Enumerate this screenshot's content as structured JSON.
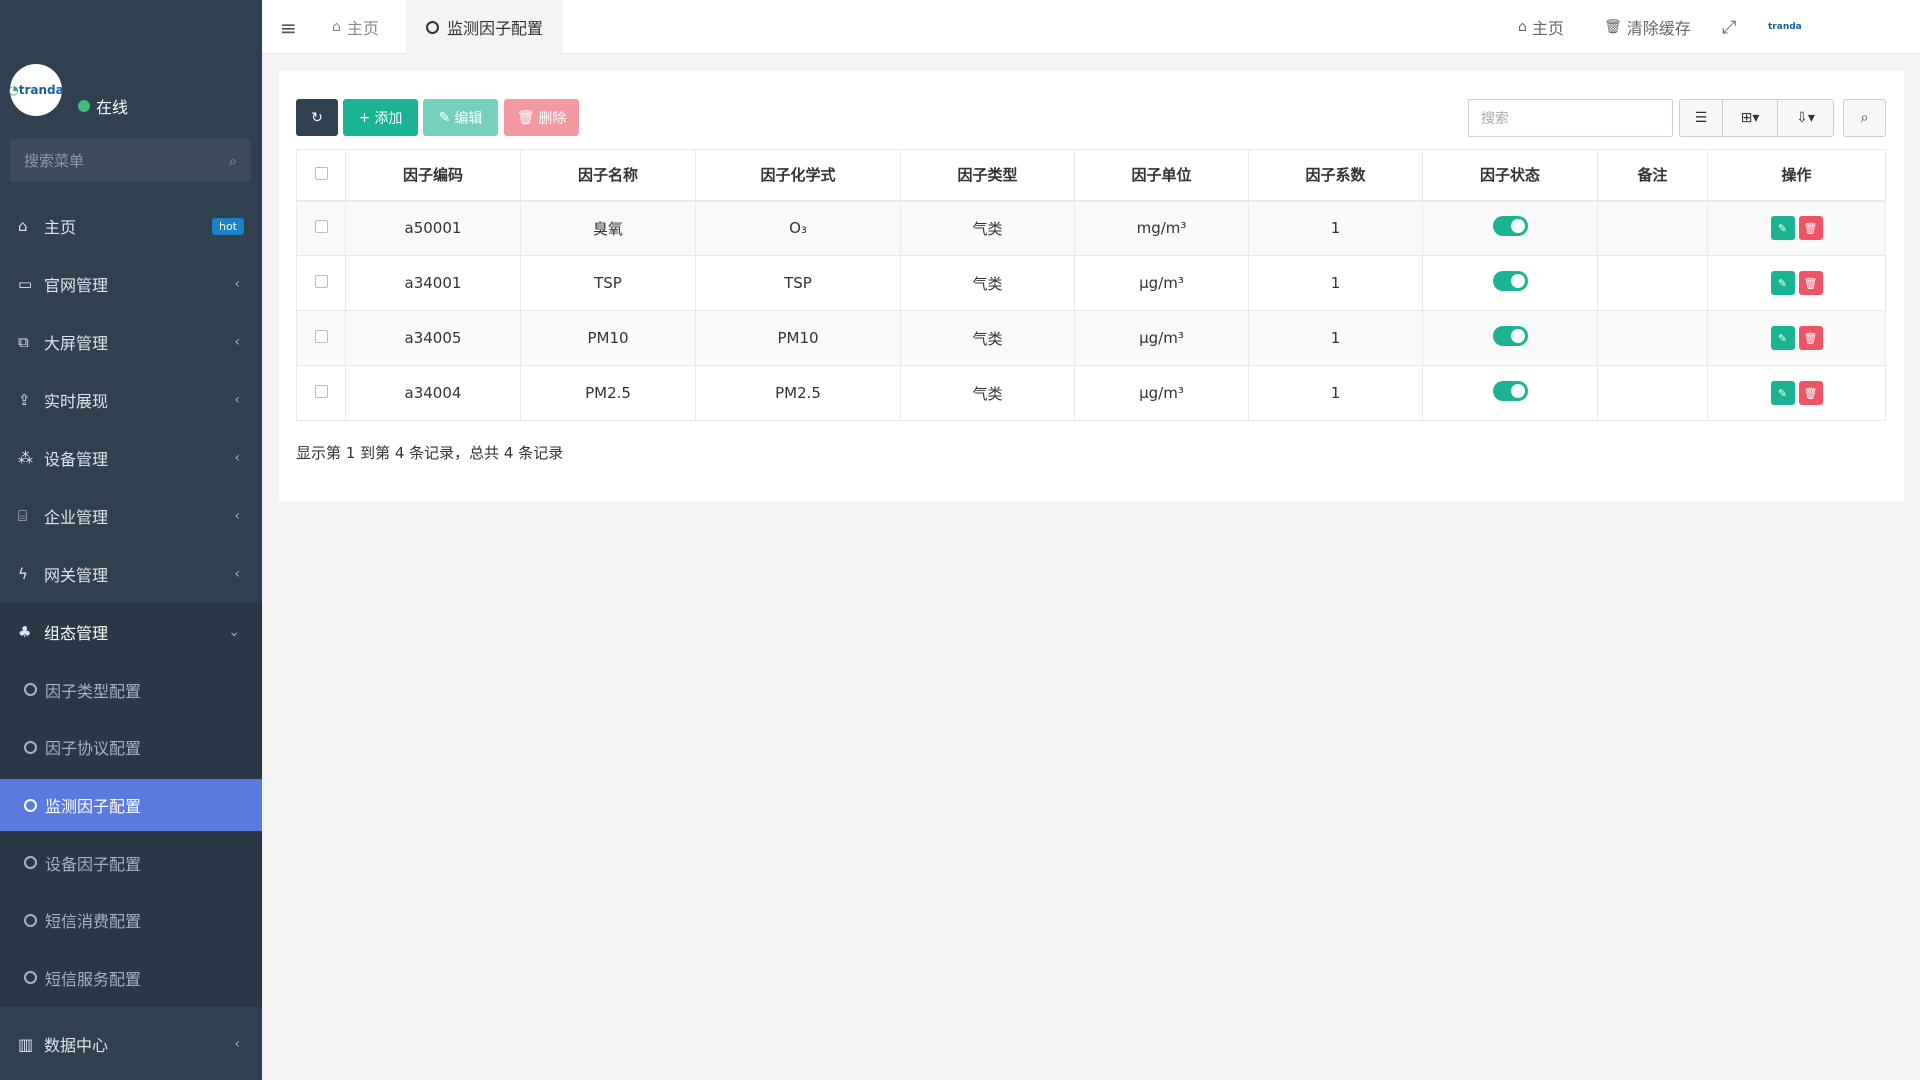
{
  "sidebar": {
    "logo_text": "tranda",
    "status": "在线",
    "search_placeholder": "搜索菜单",
    "items": [
      {
        "label": "主页",
        "icon": "home-icon",
        "badge": "hot"
      },
      {
        "label": "官网管理",
        "icon": "desktop-icon"
      },
      {
        "label": "大屏管理",
        "icon": "window-icon"
      },
      {
        "label": "实时展现",
        "icon": "upload-icon"
      },
      {
        "label": "设备管理",
        "icon": "cubes-icon"
      },
      {
        "label": "企业管理",
        "icon": "bank-icon"
      },
      {
        "label": "网关管理",
        "icon": "bolt-icon"
      },
      {
        "label": "组态管理",
        "icon": "sitemap-icon"
      }
    ],
    "submenu": [
      "因子类型配置",
      "因子协议配置",
      "监测因子配置",
      "设备因子配置",
      "短信消费配置",
      "短信服务配置"
    ],
    "bottom_item": "数据中心"
  },
  "topbar": {
    "tabs": [
      "主页",
      "监测因子配置"
    ],
    "right": {
      "home": "主页",
      "clear_cache": "清除缓存",
      "logo": "tranda"
    }
  },
  "toolbar": {
    "add": "添加",
    "edit": "编辑",
    "delete": "删除",
    "search_placeholder": "搜索"
  },
  "table": {
    "headers": [
      "因子编码",
      "因子名称",
      "因子化学式",
      "因子类型",
      "因子单位",
      "因子系数",
      "因子状态",
      "备注",
      "操作"
    ],
    "rows": [
      {
        "code": "a50001",
        "name": "臭氧",
        "formula": "O₃",
        "type": "气类",
        "unit": "mg/m³",
        "coef": "1",
        "status": true,
        "note": ""
      },
      {
        "code": "a34001",
        "name": "TSP",
        "formula": "TSP",
        "type": "气类",
        "unit": "μg/m³",
        "coef": "1",
        "status": true,
        "note": ""
      },
      {
        "code": "a34005",
        "name": "PM10",
        "formula": "PM10",
        "type": "气类",
        "unit": "μg/m³",
        "coef": "1",
        "status": true,
        "note": ""
      },
      {
        "code": "a34004",
        "name": "PM2.5",
        "formula": "PM2.5",
        "type": "气类",
        "unit": "μg/m³",
        "coef": "1",
        "status": true,
        "note": ""
      }
    ],
    "footer": "显示第 1 到第 4 条记录，总共 4 条记录"
  },
  "colors": {
    "sidebar_bg": "#2f4050",
    "active_sub": "#5a7ae0",
    "primary_green": "#1ab394",
    "danger_red": "#ed5565"
  }
}
